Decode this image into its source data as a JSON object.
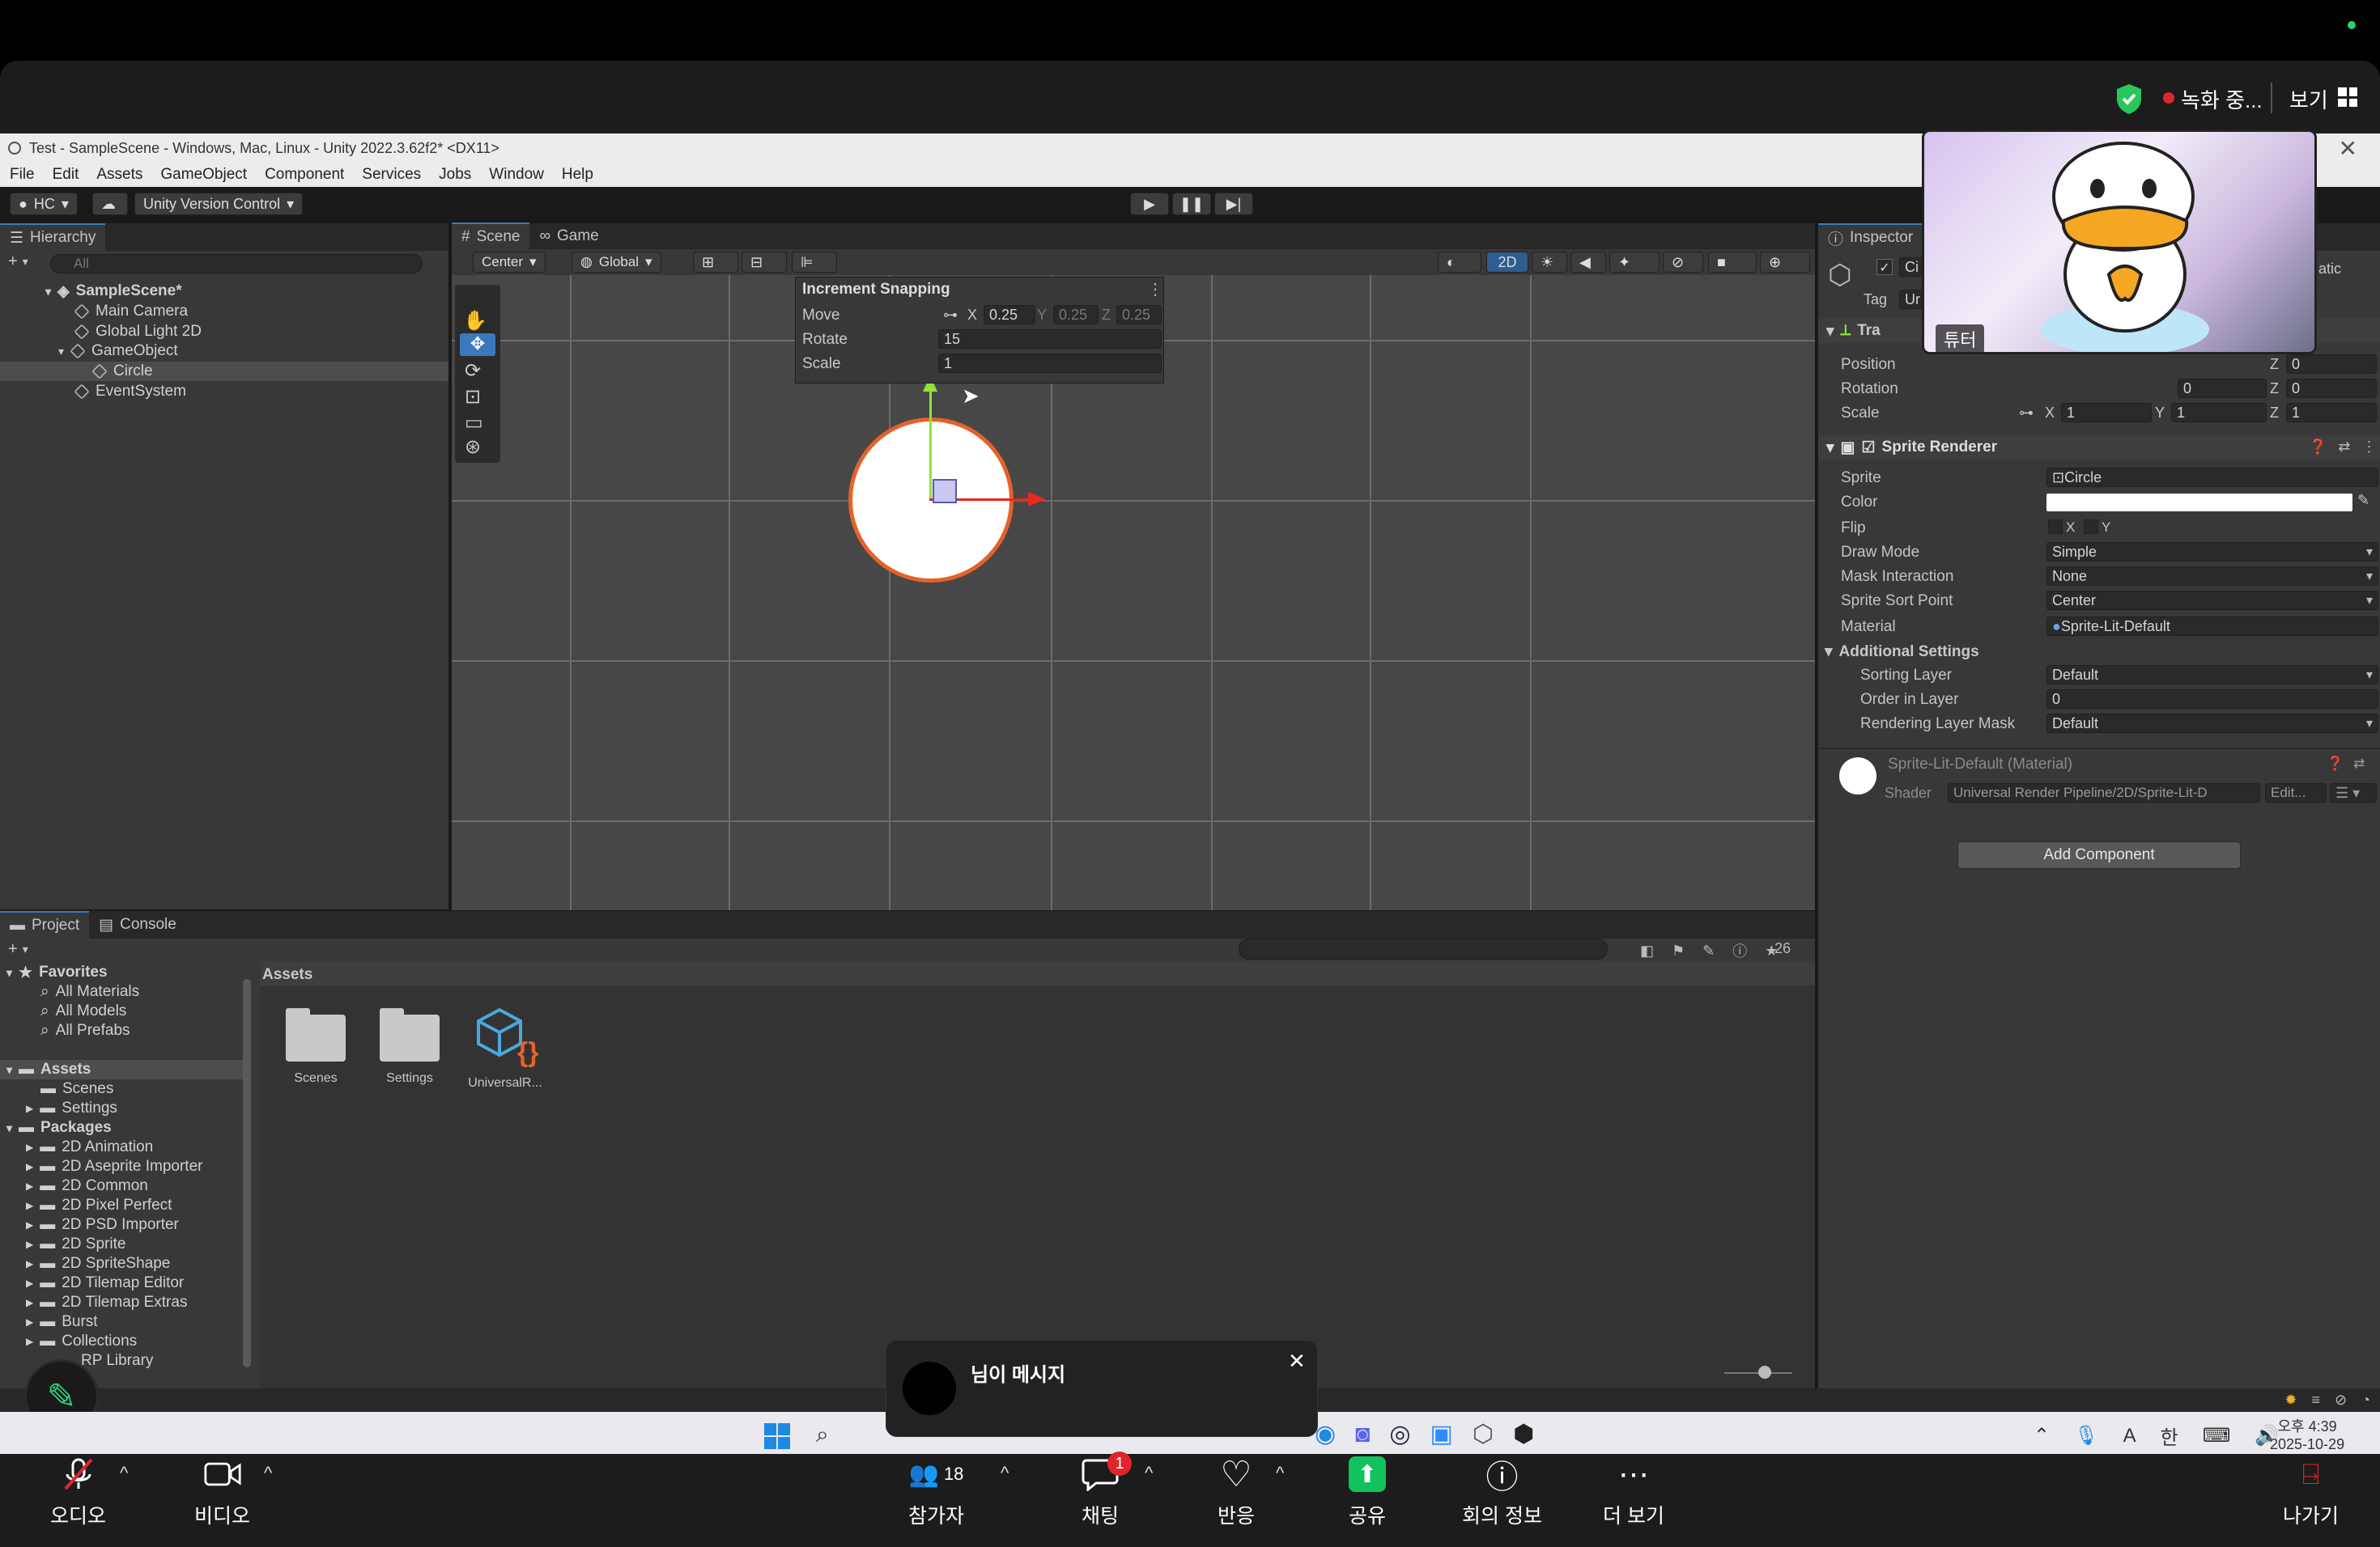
{
  "zoom_top": {
    "recording": "녹화 중...",
    "view": "보기"
  },
  "unity": {
    "title": "Test - SampleScene - Windows, Mac, Linux - Unity 2022.3.62f2* <DX11>",
    "menu": [
      "File",
      "Edit",
      "Assets",
      "GameObject",
      "Component",
      "Services",
      "Jobs",
      "Window",
      "Help"
    ],
    "toolbar": {
      "account": "HC",
      "version_control": "Unity Version Control"
    },
    "hierarchy": {
      "tab": "Hierarchy",
      "search_placeholder": "All",
      "items": [
        "SampleScene*",
        "Main Camera",
        "Global Light 2D",
        "GameObject",
        "Circle",
        "EventSystem"
      ]
    },
    "scene": {
      "tabs": [
        "Scene",
        "Game"
      ],
      "pivot": "Center",
      "space": "Global",
      "mode_2d": "2D",
      "snapping": {
        "title": "Increment Snapping",
        "move_label": "Move",
        "move_x": "0.25",
        "move_y": "0.25",
        "move_z": "0.25",
        "rotate_label": "Rotate",
        "rotate": "15",
        "scale_label": "Scale",
        "scale": "1",
        "x": "X",
        "y": "Y",
        "z": "Z"
      }
    },
    "inspector": {
      "tab": "Inspector",
      "name": "Ci",
      "static": "atic",
      "tag_label": "Tag",
      "tag": "Ur",
      "transform": {
        "header": "Tra",
        "position_label": "Position",
        "rotation_label": "Rotation",
        "scale_label": "Scale",
        "pos_z": "0",
        "rot_x": "0",
        "rot_y": "0",
        "rot_z": "0",
        "scale_x": "1",
        "scale_y": "1",
        "scale_z": "1"
      },
      "sprite_renderer": {
        "header": "Sprite Renderer",
        "sprite_label": "Sprite",
        "sprite": "Circle",
        "color_label": "Color",
        "flip_label": "Flip",
        "flip_x": "X",
        "flip_y": "Y",
        "draw_mode_label": "Draw Mode",
        "draw_mode": "Simple",
        "mask_label": "Mask Interaction",
        "mask": "None",
        "sort_point_label": "Sprite Sort Point",
        "sort_point": "Center",
        "material_label": "Material",
        "material": "Sprite-Lit-Default",
        "additional": "Additional Settings",
        "sorting_layer_label": "Sorting Layer",
        "sorting_layer": "Default",
        "order_label": "Order in Layer",
        "order": "0",
        "render_mask_label": "Rendering Layer Mask",
        "render_mask": "Default"
      },
      "material_block": {
        "name": "Sprite-Lit-Default (Material)",
        "shader_label": "Shader",
        "shader": "Universal Render Pipeline/2D/Sprite-Lit-D",
        "edit": "Edit..."
      },
      "add_component": "Add Component"
    },
    "project": {
      "tabs": [
        "Project",
        "Console"
      ],
      "count": "26",
      "favorites": {
        "label": "Favorites",
        "items": [
          "All Materials",
          "All Models",
          "All Prefabs"
        ]
      },
      "assets_label": "Assets",
      "assets_children": [
        "Scenes",
        "Settings"
      ],
      "packages_label": "Packages",
      "packages": [
        "2D Animation",
        "2D Aseprite Importer",
        "2D Common",
        "2D Pixel Perfect",
        "2D PSD Importer",
        "2D Sprite",
        "2D SpriteShape",
        "2D Tilemap Editor",
        "2D Tilemap Extras",
        "Burst",
        "Collections",
        "RP Library"
      ],
      "breadcrumb": "Assets",
      "grid": [
        "Scenes",
        "Settings",
        "UniversalR..."
      ]
    }
  },
  "video_tile": {
    "name": "튜터"
  },
  "chat_popup": {
    "title": "님이 메시지",
    "body": ""
  },
  "taskbar": {
    "time": "오후 4:39",
    "date": "2025-10-29",
    "ime": "한",
    "lang": "A"
  },
  "zoom_bottom": {
    "audio": "오디오",
    "video": "비디오",
    "participants": "참가자",
    "participants_count": "18",
    "chat": "채팅",
    "chat_badge": "1",
    "reactions": "반응",
    "share": "공유",
    "info": "회의 정보",
    "more": "더 보기",
    "leave": "나가기"
  },
  "colors": {
    "accent": "#3a79bb",
    "share_green": "#12c25c",
    "orange": "#e5622a"
  }
}
